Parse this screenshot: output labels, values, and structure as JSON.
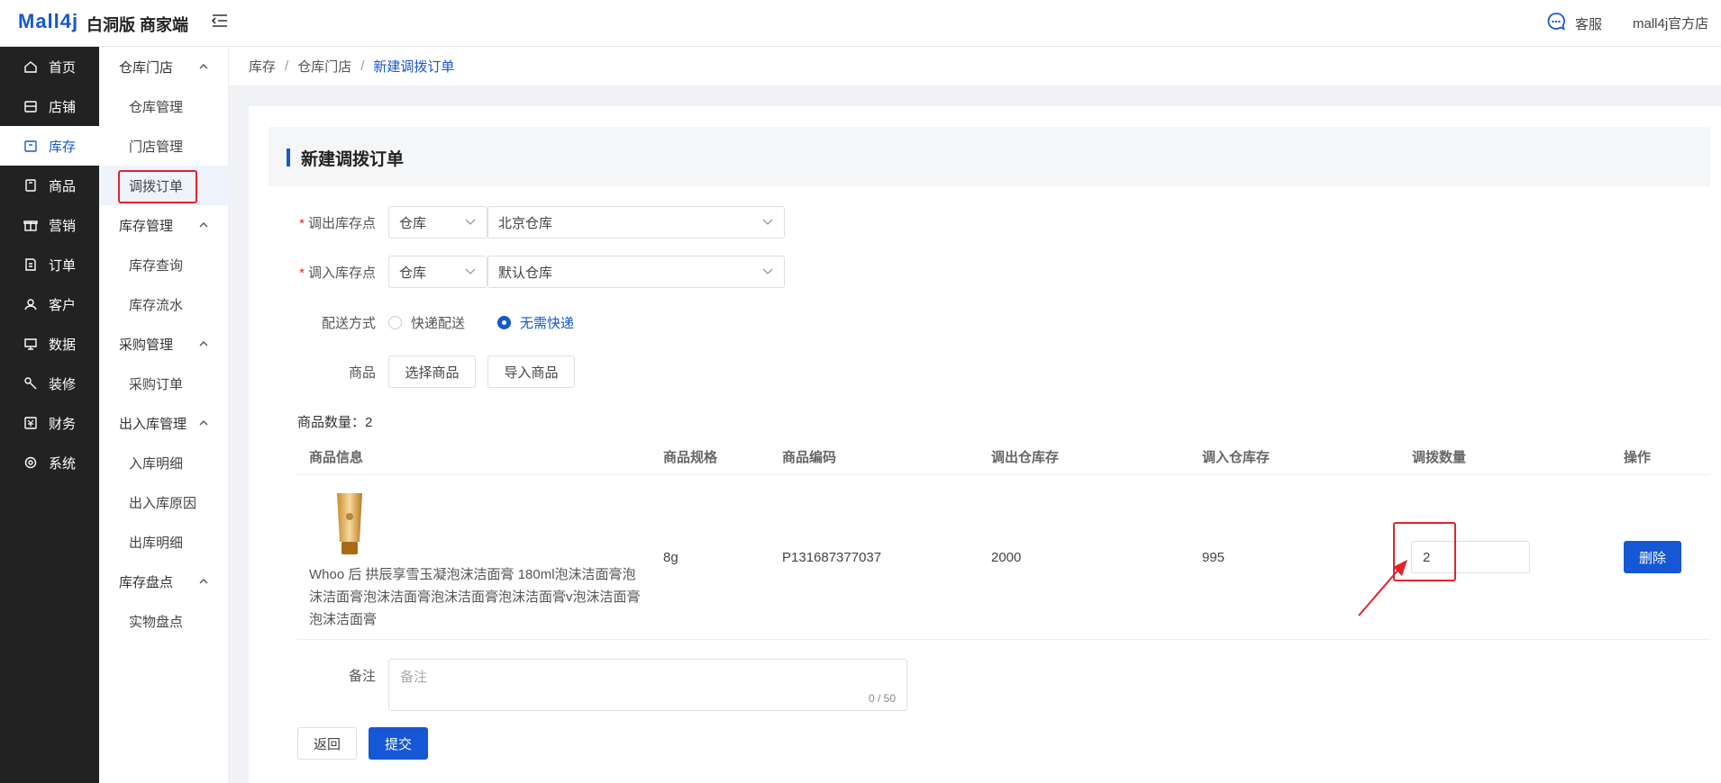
{
  "header": {
    "logo": "Mall4j",
    "subtitle": "白洞版 商家端",
    "customer_service": "客服",
    "shop_name": "mall4j官方店"
  },
  "sidebar": {
    "items": [
      {
        "label": "首页",
        "icon": "home-icon"
      },
      {
        "label": "店铺",
        "icon": "shop-icon"
      },
      {
        "label": "库存",
        "icon": "inventory-icon"
      },
      {
        "label": "商品",
        "icon": "product-icon"
      },
      {
        "label": "营销",
        "icon": "gift-icon"
      },
      {
        "label": "订单",
        "icon": "order-icon"
      },
      {
        "label": "客户",
        "icon": "customer-icon"
      },
      {
        "label": "数据",
        "icon": "data-icon"
      },
      {
        "label": "装修",
        "icon": "decorate-icon"
      },
      {
        "label": "财务",
        "icon": "finance-icon"
      },
      {
        "label": "系统",
        "icon": "system-icon"
      }
    ],
    "active_index": 2
  },
  "submenu": {
    "groups": [
      {
        "label": "仓库门店",
        "items": [
          "仓库管理",
          "门店管理",
          "调拨订单"
        ]
      },
      {
        "label": "库存管理",
        "items": [
          "库存查询",
          "库存流水"
        ]
      },
      {
        "label": "采购管理",
        "items": [
          "采购订单"
        ]
      },
      {
        "label": "出入库管理",
        "items": [
          "入库明细",
          "出入库原因",
          "出库明细"
        ]
      },
      {
        "label": "库存盘点",
        "items": [
          "实物盘点"
        ]
      }
    ],
    "active": "调拨订单"
  },
  "breadcrumb": [
    "库存",
    "仓库门店",
    "新建调拨订单"
  ],
  "form": {
    "title": "新建调拨订单",
    "out_label": "调出库存点",
    "out_type": "仓库",
    "out_value": "北京仓库",
    "in_label": "调入库存点",
    "in_type": "仓库",
    "in_value": "默认仓库",
    "delivery_label": "配送方式",
    "delivery_options": [
      "快递配送",
      "无需快递"
    ],
    "delivery_selected": "无需快递",
    "product_label": "商品",
    "select_product_btn": "选择商品",
    "import_product_btn": "导入商品",
    "count_text": "商品数量：2",
    "remark_label": "备注",
    "remark_placeholder": "备注",
    "remark_count": "0 / 50",
    "back_btn": "返回",
    "submit_btn": "提交"
  },
  "table": {
    "headers": [
      "商品信息",
      "商品规格",
      "商品编码",
      "调出仓库存",
      "调入仓库存",
      "调拨数量",
      "操作"
    ],
    "rows": [
      {
        "name": "Whoo 后 拱辰享雪玉凝泡沫洁面膏 180ml泡沫洁面膏泡沫洁面膏泡沫洁面膏泡沫洁面膏泡沫洁面膏v泡沫洁面膏泡沫洁面膏",
        "spec": "8g",
        "code": "P131687377037",
        "out_stock": "2000",
        "in_stock": "995",
        "qty": "2",
        "action": "删除"
      }
    ]
  }
}
